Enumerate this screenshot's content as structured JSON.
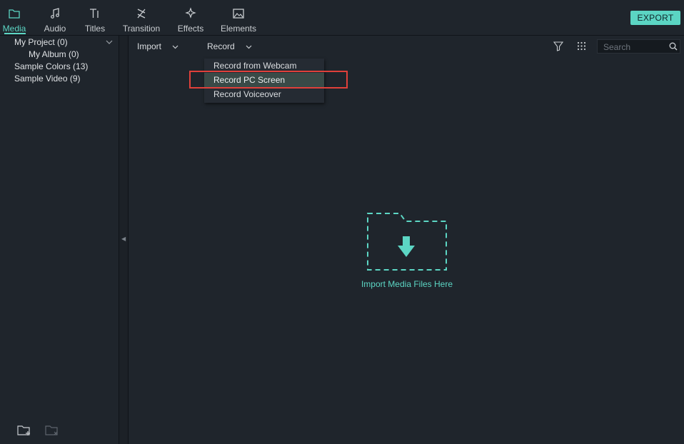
{
  "tabs": [
    {
      "label": "Media",
      "icon": "folder-icon",
      "active": true
    },
    {
      "label": "Audio",
      "icon": "music-note-icon"
    },
    {
      "label": "Titles",
      "icon": "text-tool-icon"
    },
    {
      "label": "Transition",
      "icon": "transition-icon"
    },
    {
      "label": "Effects",
      "icon": "effects-sparkle-icon"
    },
    {
      "label": "Elements",
      "icon": "image-icon"
    }
  ],
  "export_label": "EXPORT",
  "tree": [
    {
      "label": "My Project (0)"
    },
    {
      "label": "My Album (0)"
    },
    {
      "label": "Sample Colors (13)"
    },
    {
      "label": "Sample Video (9)"
    }
  ],
  "toolbar": {
    "import_label": "Import",
    "record_label": "Record"
  },
  "record_menu": [
    {
      "label": "Record from Webcam"
    },
    {
      "label": "Record PC Screen",
      "highlighted": true
    },
    {
      "label": "Record Voiceover"
    }
  ],
  "search": {
    "placeholder": "Search",
    "value": ""
  },
  "drop_zone": {
    "label": "Import Media Files Here"
  },
  "colors": {
    "accent": "#5cd6c4",
    "background": "#1f252c",
    "highlight_border": "#e0403a"
  }
}
